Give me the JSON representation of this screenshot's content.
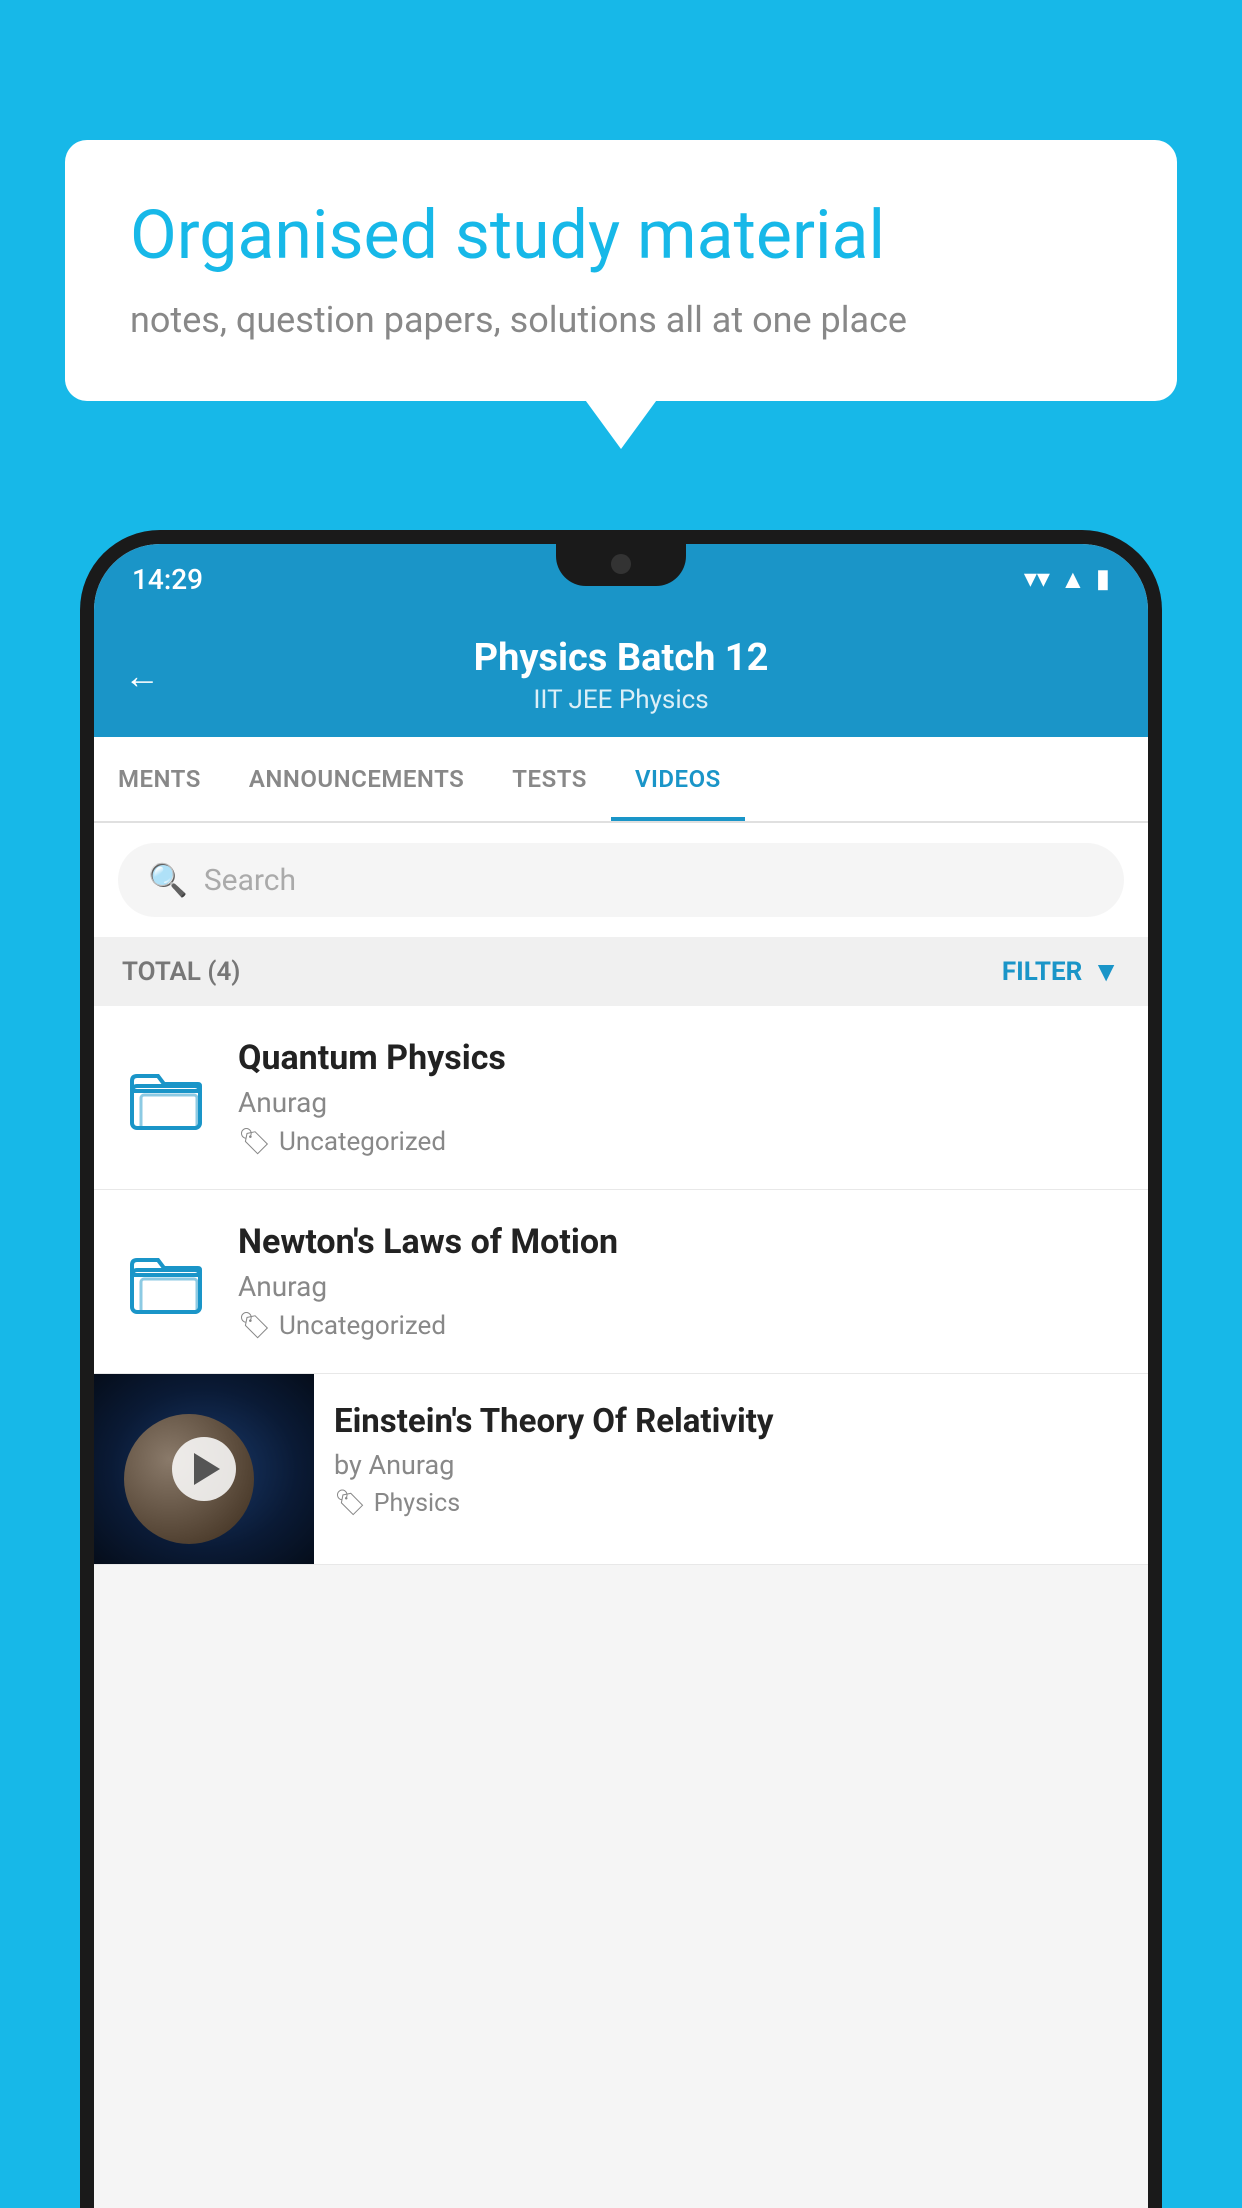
{
  "background_color": "#17b8e8",
  "speech_bubble": {
    "heading": "Organised study material",
    "subtext": "notes, question papers, solutions all at one place"
  },
  "phone": {
    "status_bar": {
      "time": "14:29"
    },
    "header": {
      "title": "Physics Batch 12",
      "subtitle": "IIT JEE   Physics",
      "back_label": "←"
    },
    "tabs": [
      {
        "label": "MENTS",
        "active": false
      },
      {
        "label": "ANNOUNCEMENTS",
        "active": false
      },
      {
        "label": "TESTS",
        "active": false
      },
      {
        "label": "VIDEOS",
        "active": true
      }
    ],
    "search": {
      "placeholder": "Search"
    },
    "filter_bar": {
      "total_label": "TOTAL (4)",
      "filter_label": "FILTER"
    },
    "videos": [
      {
        "type": "folder",
        "title": "Quantum Physics",
        "author": "Anurag",
        "tag": "Uncategorized"
      },
      {
        "type": "folder",
        "title": "Newton's Laws of Motion",
        "author": "Anurag",
        "tag": "Uncategorized"
      },
      {
        "type": "thumbnail",
        "title": "Einstein's Theory Of Relativity",
        "author": "by Anurag",
        "tag": "Physics"
      }
    ]
  }
}
